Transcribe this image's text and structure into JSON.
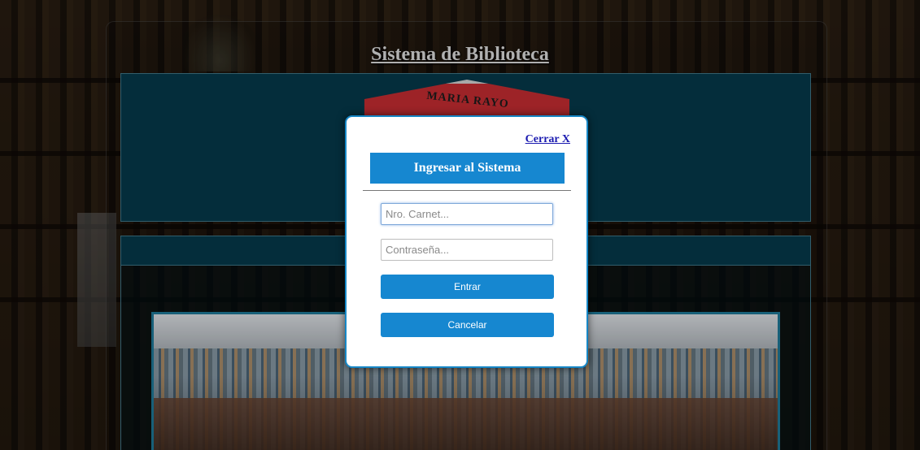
{
  "site": {
    "title": "Sistema de Biblioteca",
    "crest_text": "MARIA RAYO"
  },
  "modal": {
    "close_label": "Cerrar X",
    "header": "Ingresar al Sistema",
    "carnet_placeholder": "Nro. Carnet...",
    "carnet_value": "",
    "password_placeholder": "Contraseña...",
    "password_value": "",
    "submit_label": "Entrar",
    "cancel_label": "Cancelar"
  },
  "colors": {
    "accent": "#1687d0",
    "panel": "#053444",
    "close_link": "#1a1ab0"
  }
}
